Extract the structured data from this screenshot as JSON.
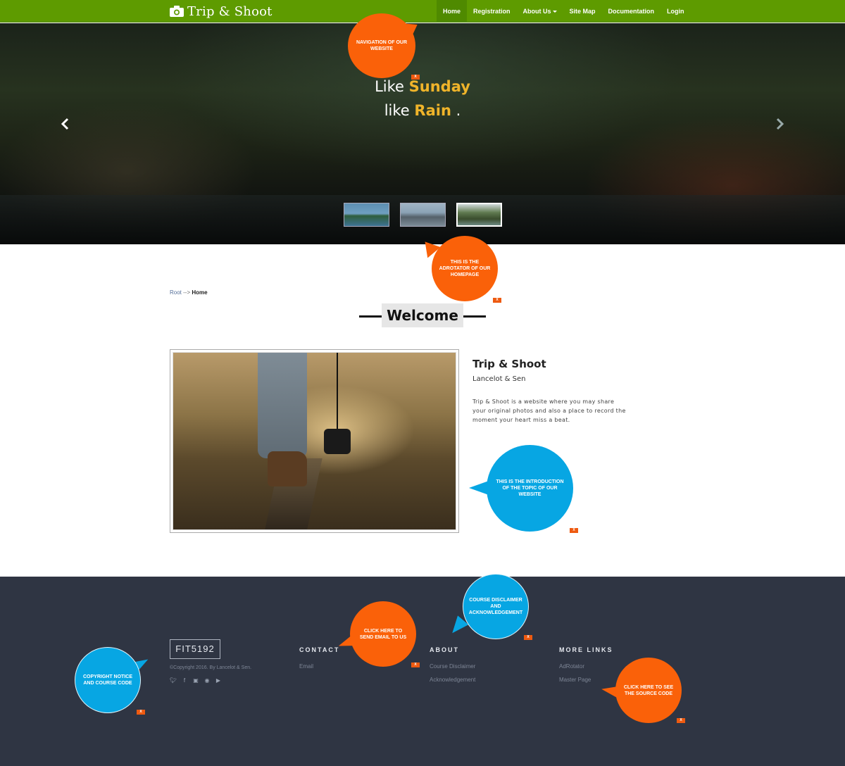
{
  "navbar": {
    "brand": "Trip & Shoot",
    "items": [
      {
        "label": "Home",
        "active": true
      },
      {
        "label": "Registration"
      },
      {
        "label": "About Us",
        "dropdown": true
      },
      {
        "label": "Site Map"
      },
      {
        "label": "Documentation"
      },
      {
        "label": "Login"
      }
    ]
  },
  "hero": {
    "line1_prefix": "Like",
    "line1_highlight": "Sunday",
    "line2_prefix": "like",
    "line2_highlight": "Rain",
    "line2_suffix": ".",
    "highlight_color": "#f0b42a"
  },
  "breadcrumb": {
    "root": "Root",
    "separator": "-->",
    "current": "Home"
  },
  "welcome": {
    "heading": "Welcome"
  },
  "intro": {
    "title": "Trip & Shoot",
    "subtitle": "Lancelot & Sen",
    "text": "Trip & Shoot is a website where you may share your original photos and also a place to record the moment your heart miss a beat."
  },
  "footer": {
    "course_code": "FIT5192",
    "copyright": "©Copyright 2016. By Lancelot & Sen.",
    "social_icons": [
      "twitter-icon",
      "facebook-icon",
      "instagram-icon",
      "github-icon",
      "youtube-icon"
    ],
    "contact": {
      "title": "CONTACT",
      "links": [
        "Email"
      ]
    },
    "about": {
      "title": "ABOUT",
      "links": [
        "Course Disclaimer",
        "Acknowledgement"
      ]
    },
    "more": {
      "title": "MORE LINKS",
      "links": [
        "AdRotator",
        "Master Page"
      ]
    }
  },
  "callouts": {
    "nav": "NAVIGATION OF OUR WEBSITE",
    "adrotator": "THIS IS THE ADROTATOR OF OUR HOMEPAGE",
    "intro": "THIS IS THE INTRODUCTION OF THE TOPIC OF OUR WEBSITE",
    "disclaimer": "COURSE DISCLAIMER AND ACKNOWLEDGEMENT",
    "email": "CLICK HERE TO SEND EMAIL TO US",
    "copyright": "COPYRIGHT NOTICE AND COURSE CODE",
    "source": "CLICK HERE TO SEE THE SOURCE CODE",
    "close_label": "X",
    "orange": "#fa6109",
    "blue": "#07a6e3"
  },
  "colors": {
    "navbar": "#5e9b00",
    "footer": "#2f3543"
  }
}
